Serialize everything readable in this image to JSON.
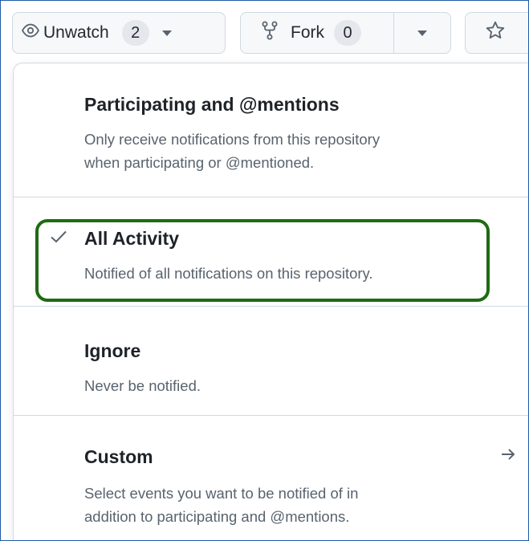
{
  "toolbar": {
    "watch_label": "Unwatch",
    "watch_count": "2",
    "fork_label": "Fork",
    "fork_count": "0"
  },
  "icons": {
    "eye": "eye-icon",
    "fork": "repo-forked-icon",
    "star": "star-icon",
    "check": "check-icon",
    "arrow": "arrow-right-icon"
  },
  "menu": {
    "items": [
      {
        "title": "Participating and @mentions",
        "desc_line1": "Only receive notifications from this repository",
        "desc_line2": "when participating or @mentioned.",
        "selected": false
      },
      {
        "title": "All Activity",
        "desc_line1": "Notified of all notifications on this repository.",
        "selected": true
      },
      {
        "title": "Ignore",
        "desc_line1": "Never be notified.",
        "selected": false
      },
      {
        "title": "Custom",
        "desc_line1": "Select events you want to be notified of in",
        "desc_line2": "addition to participating and @mentions.",
        "selected": false
      }
    ]
  },
  "colors": {
    "highlight": "#1e6b12",
    "border": "#d1d9e0",
    "muted_text": "#59636e"
  }
}
